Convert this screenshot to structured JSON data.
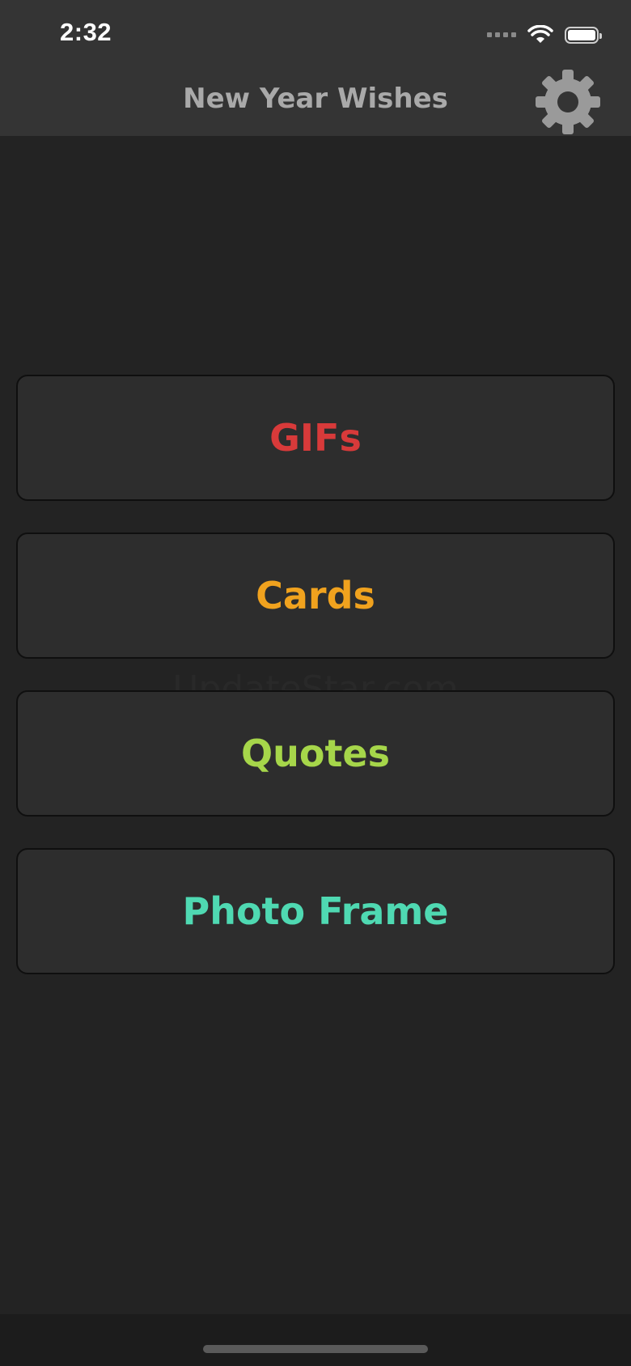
{
  "status_bar": {
    "time": "2:32",
    "icons": [
      "signal-icon",
      "wifi-icon",
      "battery-icon"
    ]
  },
  "nav_bar": {
    "title": "New Year Wishes",
    "settings_icon": "gear-icon"
  },
  "menu": {
    "items": [
      {
        "label": "GIFs",
        "color": "#d83a3a"
      },
      {
        "label": "Cards",
        "color": "#f0a21e"
      },
      {
        "label": "Quotes",
        "color": "#a6d64a"
      },
      {
        "label": "Photo Frame",
        "color": "#4fd9b2"
      }
    ]
  },
  "watermark": "UpdateStar.com",
  "colors": {
    "background": "#232323",
    "bar": "#343434",
    "button_bg": "#2d2d2d",
    "title_text": "#a9a9a9",
    "gear": "#9a9a9a"
  }
}
